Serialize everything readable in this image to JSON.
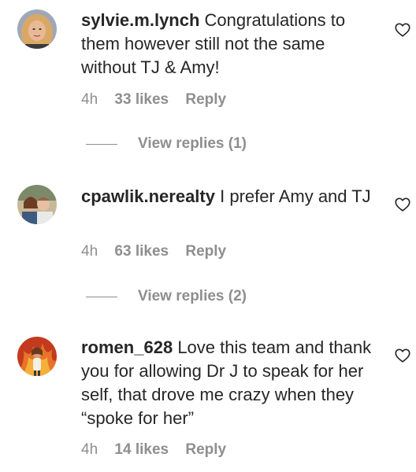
{
  "comments": [
    {
      "username": "sylvie.m.lynch",
      "text": "Congratulations to them however still not the same without TJ & Amy!",
      "time": "4h",
      "likes": "33 likes",
      "reply": "Reply",
      "view_replies": "View replies (1)"
    },
    {
      "username": "cpawlik.nerealty",
      "text": "I prefer Amy and TJ",
      "time": "4h",
      "likes": "63 likes",
      "reply": "Reply",
      "view_replies": "View replies (2)"
    },
    {
      "username": "romen_628",
      "text": "Love this team and thank you for allowing Dr J to speak for her self, that drove me crazy when they “spoke for her”",
      "time": "4h",
      "likes": "14 likes",
      "reply": "Reply"
    }
  ],
  "icons": {
    "like": "heart-outline-icon"
  },
  "colors": {
    "text": "#262626",
    "secondary": "#8e8e8e"
  }
}
